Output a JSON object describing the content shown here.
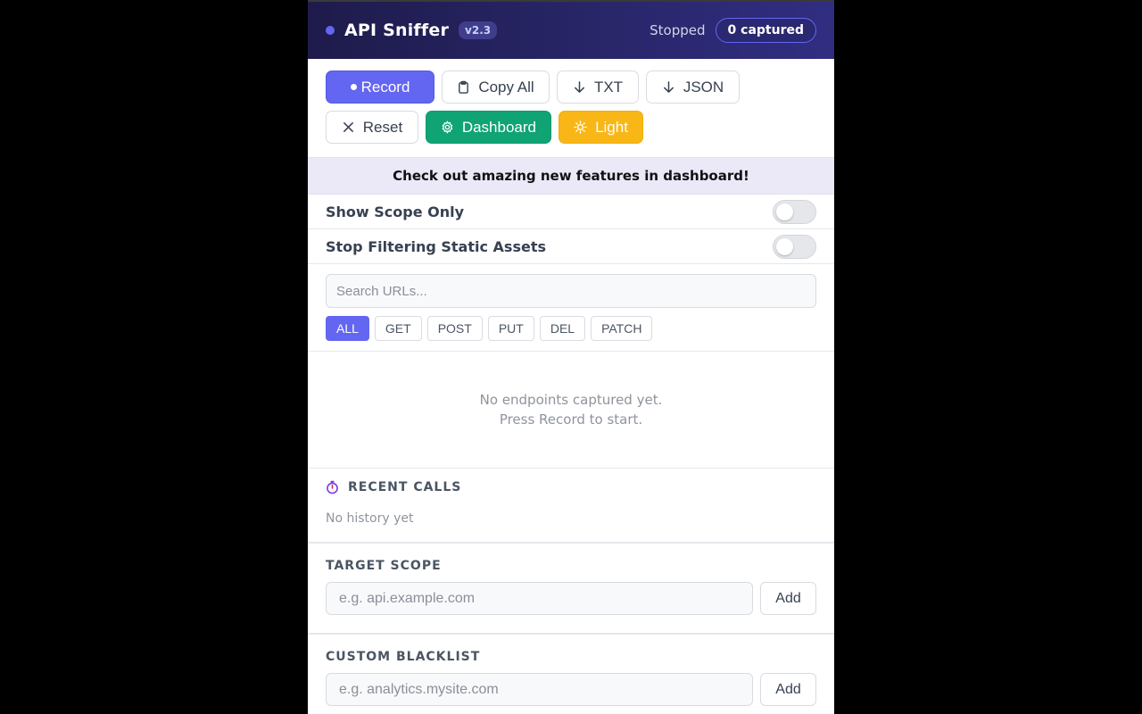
{
  "header": {
    "title": "API Sniffer",
    "version": "v2.3",
    "status": "Stopped",
    "captured": "0 captured"
  },
  "toolbar": {
    "record": "Record",
    "copy_all": "Copy All",
    "txt": "TXT",
    "json": "JSON",
    "reset": "Reset",
    "dashboard": "Dashboard",
    "light": "Light"
  },
  "banner": "Check out amazing new features in dashboard!",
  "toggles": {
    "scope_only": "Show Scope Only",
    "static_assets": "Stop Filtering Static Assets"
  },
  "search": {
    "placeholder": "Search URLs..."
  },
  "filters": [
    "ALL",
    "GET",
    "POST",
    "PUT",
    "DEL",
    "PATCH"
  ],
  "empty_state": {
    "line1": "No endpoints captured yet.",
    "line2": "Press Record to start."
  },
  "recent": {
    "heading": "RECENT CALLS",
    "empty": "No history yet"
  },
  "target_scope": {
    "heading": "TARGET SCOPE",
    "placeholder": "e.g. api.example.com",
    "add": "Add"
  },
  "custom_blacklist": {
    "heading": "CUSTOM BLACKLIST",
    "placeholder": "e.g. analytics.mysite.com",
    "add": "Add"
  },
  "colors": {
    "accent": "#6366f1",
    "dashboard": "#10a374",
    "light": "#f8b716",
    "header": "#1e1b4b"
  }
}
